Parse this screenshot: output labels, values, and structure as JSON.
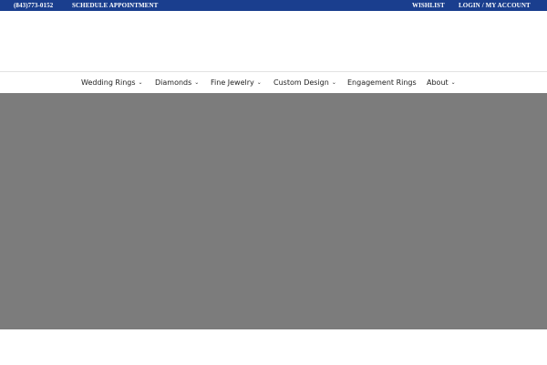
{
  "topbar": {
    "bg_color": "#1a3e8e",
    "phone": "(843)773-0152",
    "schedule": "SCHEDULE APPOINTMENT",
    "wishlist": "WISHLIST",
    "login": "LOGIN / MY ACCOUNT"
  },
  "nav": {
    "items": [
      {
        "label": "Wedding Rings",
        "has_dropdown": true,
        "icon": "chevron-down-icon"
      },
      {
        "label": "Diamonds",
        "has_dropdown": true,
        "icon": "chevron-down-icon"
      },
      {
        "label": "Fine Jewelry",
        "has_dropdown": true,
        "icon": "chevron-down-icon"
      },
      {
        "label": "Custom Design",
        "has_dropdown": true,
        "icon": "chevron-down-icon"
      },
      {
        "label": "Engagement Rings",
        "has_dropdown": false
      },
      {
        "label": "About",
        "has_dropdown": true,
        "icon": "chevron-down-icon"
      }
    ],
    "chevron_glyph": "⌄"
  },
  "hero": {
    "bg_color": "#7c7c7c"
  }
}
